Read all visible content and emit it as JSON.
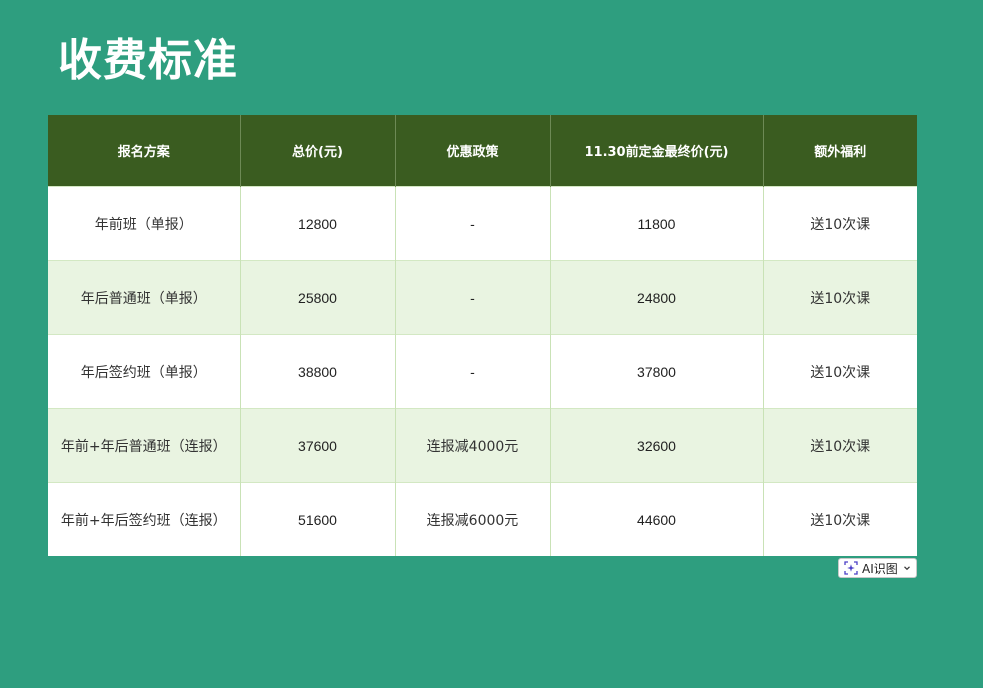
{
  "title": "收费标准",
  "table": {
    "headers": [
      "报名方案",
      "总价(元)",
      "优惠政策",
      "11.30前定金最终价(元)",
      "额外福利"
    ],
    "rows": [
      [
        "年前班（单报）",
        "12800",
        "-",
        "11800",
        "送10次课"
      ],
      [
        "年后普通班（单报）",
        "25800",
        "-",
        "24800",
        "送10次课"
      ],
      [
        "年后签约班（单报）",
        "38800",
        "-",
        "37800",
        "送10次课"
      ],
      [
        "年前+年后普通班（连报）",
        "37600",
        "连报减4000元",
        "32600",
        "送10次课"
      ],
      [
        "年前+年后签约班（连报）",
        "51600",
        "连报减6000元",
        "44600",
        "送10次课"
      ]
    ]
  },
  "ai_badge": {
    "label": "AI识图",
    "icon": "ai-sparkle-icon",
    "chevron_icon": "chevron-down-icon"
  },
  "colors": {
    "background": "#2e9e7f",
    "header_bg": "#3a5c20",
    "row_alt_bg": "#e9f4e1",
    "row_bg": "#ffffff"
  }
}
